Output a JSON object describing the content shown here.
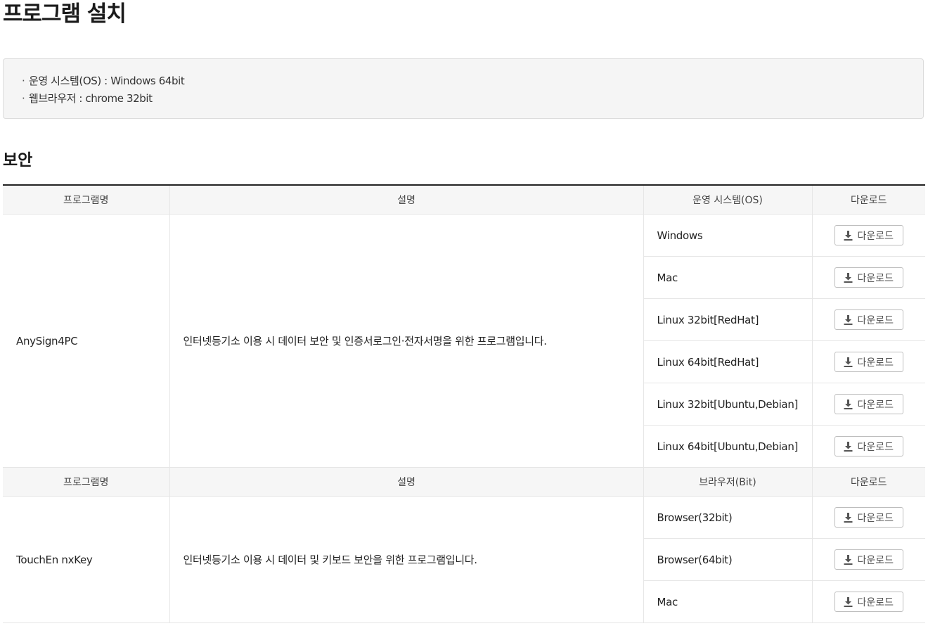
{
  "page": {
    "title": "프로그램 설치"
  },
  "info": {
    "bullet": "·",
    "lines": [
      "운영 시스템(OS) : Windows 64bit",
      "웹브라우저 : chrome 32bit"
    ]
  },
  "section": {
    "title": "보안"
  },
  "table": {
    "download_label": "다운로드",
    "icon": "download-icon",
    "groups": [
      {
        "headers": [
          "프로그램명",
          "설명",
          "운영 시스템(OS)",
          "다운로드"
        ],
        "name": "AnySign4PC",
        "description": "인터넷등기소 이용 시 데이터 보안 및 인증서로그인·전자서명을 위한 프로그램입니다.",
        "rows": [
          "Windows",
          "Mac",
          "Linux 32bit[RedHat]",
          "Linux 64bit[RedHat]",
          "Linux 32bit[Ubuntu,Debian]",
          "Linux 64bit[Ubuntu,Debian]"
        ]
      },
      {
        "headers": [
          "프로그램명",
          "설명",
          "브라우저(Bit)",
          "다운로드"
        ],
        "name": "TouchEn nxKey",
        "description": "인터넷등기소 이용 시 데이터 및 키보드 보안을 위한 프로그램입니다.",
        "rows": [
          "Browser(32bit)",
          "Browser(64bit)",
          "Mac"
        ]
      }
    ]
  }
}
